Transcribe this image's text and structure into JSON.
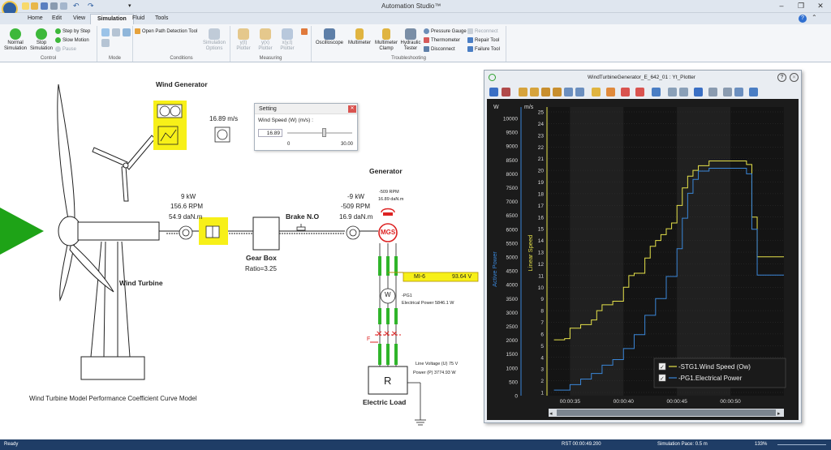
{
  "app": {
    "title": "Automation Studio™",
    "tabs": [
      "Home",
      "Edit",
      "View",
      "Simulation",
      "Fluid",
      "Tools"
    ],
    "active_tab": "Simulation"
  },
  "ribbon": {
    "control": {
      "label": "Control",
      "normal_simulation": "Normal Simulation",
      "stop_simulation": "Stop Simulation",
      "step_by_step": "Step by Step",
      "slow_motion": "Slow Motion",
      "pause": "Pause"
    },
    "mode": {
      "label": "Mode"
    },
    "conditions": {
      "label": "Conditions",
      "open_path": "Open Path Detection Tool",
      "simulation_options": "Simulation Options"
    },
    "measuring": {
      "label": "Measuring",
      "yt_plotter": "y(t) Plotter",
      "yx_plotter": "y(x) Plotter",
      "xyt_plotter": "x(y,t) Plotter"
    },
    "troubleshooting": {
      "label": "Troubleshooting",
      "oscilloscope": "Oscilloscope",
      "multimeter": "Multimeter",
      "multimeter_clamp": "Multimeter Clamp",
      "hydraulic_tester": "Hydraulic Tester",
      "pressure_gauge": "Pressure Gauge",
      "thermometer": "Thermometer",
      "disconnect": "Disconnect",
      "reconnect": "Reconnect",
      "repair_tool": "Repair Tool",
      "failure_tool": "Failure Tool"
    }
  },
  "diagram": {
    "wind_generator": "Wind Generator",
    "wind_speed": "16.89 m/s",
    "wind_turbine": "Wind Turbine",
    "rotor": {
      "power": "9 kW",
      "rpm": "156.6 RPM",
      "torque": "54.9 daN.m"
    },
    "gearbox": {
      "title": "Gear Box",
      "ratio": "Ratio=3.25"
    },
    "brake": "Brake N.O",
    "gen_shaft": {
      "power": "-9 kW",
      "rpm": "-509 RPM",
      "torque": "16.9 daN.m"
    },
    "generator": {
      "title": "Generator",
      "rpm": "-509 RPM",
      "torque": "16.89 daN.m",
      "label": "MGS"
    },
    "mi6": {
      "label": "MI-6",
      "value": "93.64 V"
    },
    "pg1": {
      "name": "-PG1",
      "power": "Electrical Power 5846.1 W",
      "symbol": "W"
    },
    "fuse": "F",
    "load": {
      "voltage": "Line Voltage (U) 75 V",
      "power": "Power (P) 3774.93 W",
      "symbol": "R",
      "title": "Electric Load"
    },
    "footer": "Wind Turbine Model Performance Coefficient Curve Model"
  },
  "setting_dialog": {
    "title": "Setting",
    "label": "Wind Speed (W) (m/s) :",
    "value": "16.89",
    "min": "0",
    "max": "30.00",
    "slider_fraction": 0.563
  },
  "plotter": {
    "title": "WindTurbineGenerator_E_642_01 : Yt_Plotter"
  },
  "chart_data": {
    "type": "line",
    "x_ticks": [
      "00:00:35",
      "00:00:40",
      "00:00:45",
      "00:00:50"
    ],
    "left_axis": {
      "label": "Active Power",
      "unit": "W",
      "ticks": [
        "10000",
        "9500",
        "9000",
        "8500",
        "8000",
        "7500",
        "7000",
        "6500",
        "6000",
        "5500",
        "5000",
        "4500",
        "4000",
        "3500",
        "3000",
        "2500",
        "2000",
        "1500",
        "1000",
        "500",
        "0"
      ],
      "range": [
        0,
        10000
      ]
    },
    "right_axis": {
      "label": "Linear Speed",
      "unit": "m/s",
      "ticks": [
        "25",
        "24",
        "23",
        "22",
        "21",
        "20",
        "19",
        "18",
        "17",
        "16",
        "15",
        "14",
        "13",
        "12",
        "11",
        "10",
        "9",
        "8",
        "7",
        "6",
        "5",
        "4",
        "3",
        "2",
        "1"
      ],
      "range": [
        1,
        25
      ]
    },
    "legend": {
      "placement": "bottom-right",
      "entries": [
        "-STG1.Wind Speed (Ow)",
        "-PG1.Electrical Power"
      ]
    },
    "grid": true,
    "series": [
      {
        "name": "-STG1.Wind Speed (Ow)",
        "axis": "right",
        "color": "#e6e24a",
        "t": [
          33.5,
          34.5,
          35,
          36,
          37,
          37.5,
          38,
          39,
          40,
          40.5,
          41,
          42,
          42.5,
          43,
          43.5,
          44,
          44.5,
          45,
          45.5,
          46,
          46.5,
          47,
          48,
          49,
          50,
          50.5,
          51,
          51.5,
          52,
          52.5,
          55
        ],
        "values": [
          5.5,
          5.6,
          6.5,
          6.8,
          7.2,
          8,
          8.5,
          8.8,
          10,
          11,
          11.2,
          12.5,
          13.5,
          14,
          14.5,
          15,
          15.5,
          17,
          18.5,
          19.5,
          20,
          20.4,
          20.8,
          20.8,
          20.8,
          20.8,
          20.8,
          20.5,
          16,
          12.6,
          12.6
        ]
      },
      {
        "name": "-PG1.Electrical Power",
        "axis": "left",
        "color": "#3a86d8",
        "t": [
          33.5,
          35,
          36,
          37,
          38,
          39,
          40,
          41,
          42,
          43,
          44,
          45,
          45.5,
          46,
          46.5,
          47,
          48,
          49,
          50,
          51,
          51.5,
          52,
          52.5,
          55
        ],
        "values": [
          200,
          400,
          600,
          800,
          1100,
          1300,
          1700,
          2200,
          2900,
          3500,
          4300,
          5300,
          6400,
          7300,
          7800,
          8100,
          8200,
          8200,
          8200,
          8200,
          8000,
          6000,
          4350,
          4350
        ]
      }
    ]
  },
  "status": {
    "left": "Ready",
    "time": "RST 00:00:49.200",
    "pace": "Simulation Pace: 0.5 m",
    "zoom": "133%"
  },
  "colors": {
    "highlight": "#f7f018",
    "green_arrow": "#1ea317",
    "plot_bg": "#141414",
    "status_bg": "#1f3d66"
  }
}
